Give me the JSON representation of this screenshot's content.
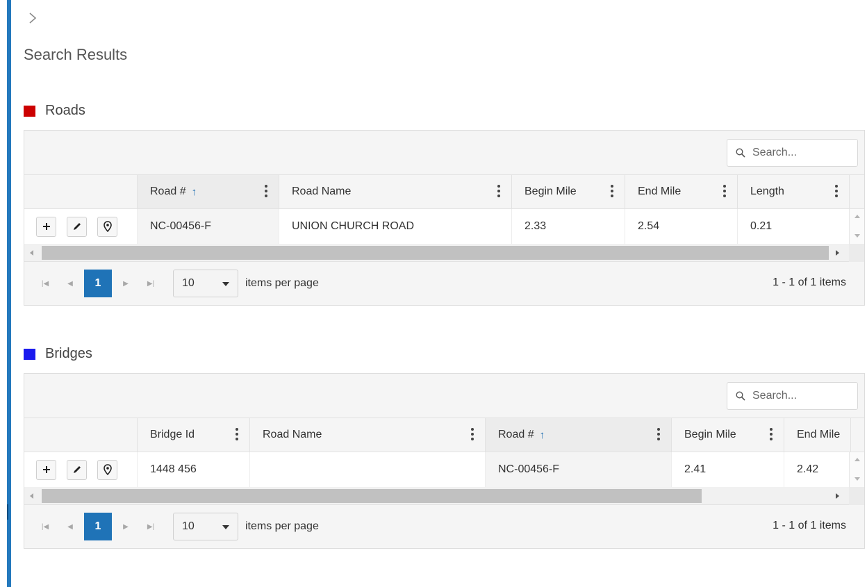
{
  "page": {
    "title": "Search Results",
    "toggle_icon": "chevron-right-icon"
  },
  "colors": {
    "accent": "#2479bd",
    "roads_swatch": "#cc0000",
    "bridges_swatch": "#1a1aee",
    "active_page": "#1f73b7"
  },
  "roads": {
    "heading": "Roads",
    "search_placeholder": "Search...",
    "columns": [
      {
        "label": "Road #",
        "sorted": "asc"
      },
      {
        "label": "Road Name"
      },
      {
        "label": "Begin Mile"
      },
      {
        "label": "End Mile"
      },
      {
        "label": "Length"
      }
    ],
    "rows": [
      {
        "road_no": "NC-00456-F",
        "road_name": "UNION CHURCH ROAD",
        "begin_mile": "2.33",
        "end_mile": "2.54",
        "length": "0.21"
      }
    ],
    "row_actions": [
      "plus-icon",
      "pencil-icon",
      "map-pin-icon"
    ],
    "pager": {
      "current_page": "1",
      "page_size": "10",
      "items_per_page_label": "items per page",
      "info": "1 - 1 of 1 items"
    }
  },
  "bridges": {
    "heading": "Bridges",
    "search_placeholder": "Search...",
    "columns": [
      {
        "label": "Bridge Id"
      },
      {
        "label": "Road Name"
      },
      {
        "label": "Road #",
        "sorted": "asc"
      },
      {
        "label": "Begin Mile"
      },
      {
        "label": "End Mile"
      }
    ],
    "rows": [
      {
        "bridge_id": "1448 456",
        "road_name": "",
        "road_no": "NC-00456-F",
        "begin_mile": "2.41",
        "end_mile": "2.42"
      }
    ],
    "row_actions": [
      "plus-icon",
      "pencil-icon",
      "map-pin-icon"
    ],
    "pager": {
      "current_page": "1",
      "page_size": "10",
      "items_per_page_label": "items per page",
      "info": "1 - 1 of 1 items"
    }
  }
}
